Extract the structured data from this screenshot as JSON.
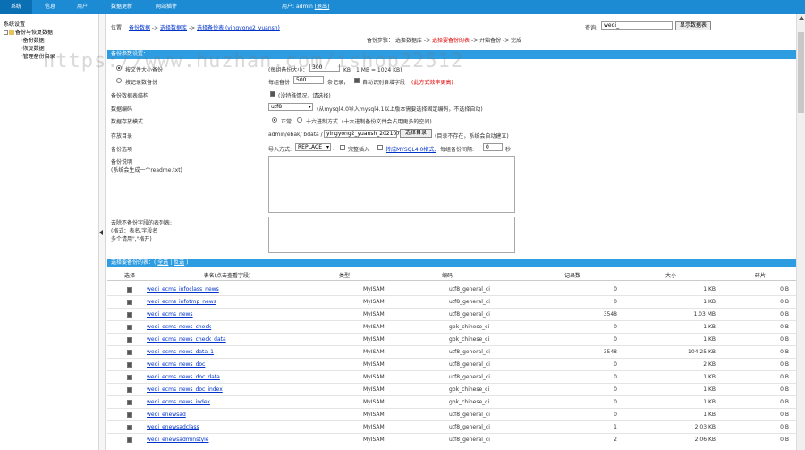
{
  "nav": {
    "items": [
      {
        "label": "系统"
      },
      {
        "label": "信息"
      },
      {
        "label": "用户"
      },
      {
        "label": "数据更新"
      },
      {
        "label": "网站插件"
      }
    ],
    "user_prefix": "用户:",
    "user_name": "admin",
    "logout": "[退出]"
  },
  "sidebar": {
    "title": "系统设置",
    "items": [
      {
        "label": "备份与恢复数据"
      },
      {
        "label": "备份数据"
      },
      {
        "label": "恢复数据"
      },
      {
        "label": "管理备份目录"
      }
    ]
  },
  "location": {
    "prefix": "位置：",
    "crumbs": [
      "备份数据",
      "选择数据库",
      "选择备份表 (yingyong2_yuansh)"
    ],
    "sep": "->",
    "query_label": "查询:",
    "query_value": "weqi_",
    "query_button": "显示数据表"
  },
  "steps": {
    "label": "备份步骤：",
    "items": [
      "选择数据库",
      "选择要备份的表",
      "开始备份",
      "完成"
    ],
    "sep": "->",
    "current_index": 1
  },
  "params": {
    "header": "备份参数设置：",
    "radio_filesize_label": "按文件大小备份",
    "filesize_note_prefix": "(每组备份大小：",
    "filesize_value": "300",
    "filesize_note_suffix": "KB，1 MB = 1024 KB)",
    "radio_rows_label": "按记录数备份",
    "rows_prefix": "每组备份",
    "rows_value": "500",
    "rows_suffix": "条记录，",
    "auto_field_label": "自动识别自增字段",
    "auto_field_note": "(此方式效率更高)",
    "structure_label": "备份数据表结构",
    "structure_note": "(没特殊情况，请选择)",
    "charset_label": "数据编码",
    "charset_value": "utf8",
    "charset_note": "(从mysql4.0导入mysql4.1以上版本需要选择固定编码，不选择自动)",
    "store_label": "数据存放模式",
    "store_normal": "正常",
    "store_hex": "十六进制方式",
    "store_hex_note": "(十六进制备份文件会占用更多的空间)",
    "dir_label": "存放目录",
    "dir_prefix": "admin/ebak/ bdata /",
    "dir_value": "yingyong2_yuansh_202107",
    "dir_button": "选择目录",
    "dir_note": "(目录不存在，系统会自动建立)",
    "options_label": "备份选项",
    "import_label": "导入方式:",
    "import_value": "REPLACE",
    "complete_insert": "完整插入",
    "mysql40_label": "转成MYSQL4.0格式,",
    "interval_label": "每组备份间隔:",
    "interval_value": "0",
    "interval_unit": "秒",
    "readme_label": "备份说明",
    "readme_note": "(系统会生成一个readme.txt)",
    "skip_label": "去除不备份字段的表列表:",
    "skip_note1": "(格式：表名.字段名",
    "skip_note2": "多个请用\",\"格开)"
  },
  "tables": {
    "header_prefix": "选择要备份的表：(",
    "select_all": "全选",
    "divider": "|",
    "invert": "反选",
    "header_suffix": ")",
    "columns": [
      "选择",
      "表名(点击查看字段)",
      "类型",
      "编码",
      "记录数",
      "大小",
      "碎片"
    ],
    "rows": [
      {
        "name": "weqi_ecms_infoclass_news",
        "type": "MyISAM",
        "charset": "utf8_general_ci",
        "records": "0",
        "size": "1 KB",
        "frag": "0 B"
      },
      {
        "name": "weqi_ecms_infotmp_news",
        "type": "MyISAM",
        "charset": "utf8_general_ci",
        "records": "0",
        "size": "1 KB",
        "frag": "0 B"
      },
      {
        "name": "weqi_ecms_news",
        "type": "MyISAM",
        "charset": "utf8_general_ci",
        "records": "3548",
        "size": "1.03 MB",
        "frag": "0 B"
      },
      {
        "name": "weqi_ecms_news_check",
        "type": "MyISAM",
        "charset": "gbk_chinese_ci",
        "records": "0",
        "size": "1 KB",
        "frag": "0 B"
      },
      {
        "name": "weqi_ecms_news_check_data",
        "type": "MyISAM",
        "charset": "gbk_chinese_ci",
        "records": "0",
        "size": "1 KB",
        "frag": "0 B"
      },
      {
        "name": "weqi_ecms_news_data_1",
        "type": "MyISAM",
        "charset": "utf8_general_ci",
        "records": "3548",
        "size": "104.25 KB",
        "frag": "0 B"
      },
      {
        "name": "weqi_ecms_news_doc",
        "type": "MyISAM",
        "charset": "utf8_general_ci",
        "records": "0",
        "size": "2 KB",
        "frag": "0 B"
      },
      {
        "name": "weqi_ecms_news_doc_data",
        "type": "MyISAM",
        "charset": "utf8_general_ci",
        "records": "0",
        "size": "1 KB",
        "frag": "0 B"
      },
      {
        "name": "weqi_ecms_news_doc_index",
        "type": "MyISAM",
        "charset": "gbk_chinese_ci",
        "records": "0",
        "size": "1 KB",
        "frag": "0 B"
      },
      {
        "name": "weqi_ecms_news_index",
        "type": "MyISAM",
        "charset": "gbk_chinese_ci",
        "records": "0",
        "size": "1 KB",
        "frag": "0 B"
      },
      {
        "name": "weqi_enewsad",
        "type": "MyISAM",
        "charset": "utf8_general_ci",
        "records": "0",
        "size": "1 KB",
        "frag": "0 B"
      },
      {
        "name": "weqi_enewsadclass",
        "type": "MyISAM",
        "charset": "utf8_general_ci",
        "records": "1",
        "size": "2.03 KB",
        "frag": "0 B"
      },
      {
        "name": "weqi_enewsadminstyle",
        "type": "MyISAM",
        "charset": "utf8_general_ci",
        "records": "2",
        "size": "2.06 KB",
        "frag": "0 B"
      }
    ]
  },
  "watermark": "https://www.huzhan.com/ishop22512",
  "colors": {
    "topbar": "#1c8bd4",
    "section": "#2d9ce0",
    "highlight": "#dd0000"
  }
}
